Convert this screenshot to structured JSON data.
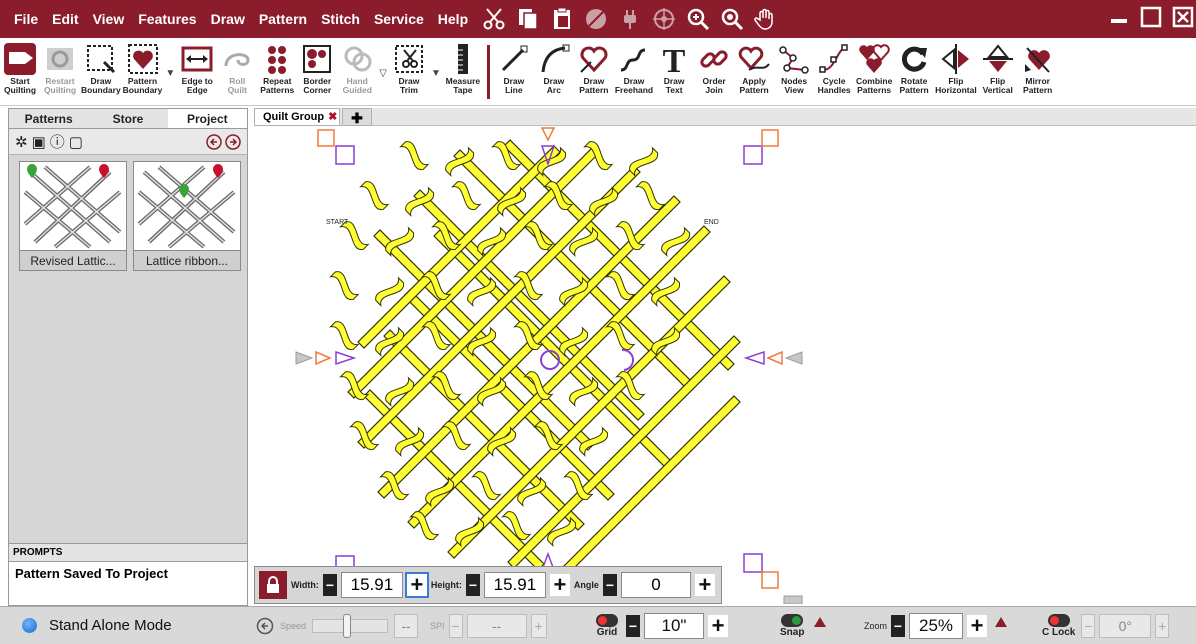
{
  "menu": [
    "File",
    "Edit",
    "View",
    "Features",
    "Draw",
    "Pattern",
    "Stitch",
    "Service",
    "Help"
  ],
  "menu_icons": [
    "scissors-icon",
    "copy-icon",
    "paste-icon",
    "no-entry-icon",
    "plug-icon",
    "crosshair-icon",
    "zoom-in-icon",
    "zoom-all-icon",
    "pan-hand-icon"
  ],
  "ribbon": [
    {
      "label": "Start\nQuilting",
      "icon": "start-quilting-icon",
      "disabled": false
    },
    {
      "label": "Restart\nQuilting",
      "icon": "restart-quilting-icon",
      "disabled": true
    },
    {
      "label": "Draw\nBoundary",
      "icon": "draw-boundary-icon",
      "disabled": false
    },
    {
      "label": "Pattern\nBoundary",
      "icon": "pattern-boundary-icon",
      "disabled": false,
      "dropdown": true
    },
    {
      "label": "Edge to\nEdge",
      "icon": "edge-to-edge-icon",
      "disabled": false
    },
    {
      "label": "Roll\nQuilt",
      "icon": "roll-quilt-icon",
      "disabled": true
    },
    {
      "label": "Repeat\nPatterns",
      "icon": "repeat-patterns-icon",
      "disabled": false
    },
    {
      "label": "Border\nCorner",
      "icon": "border-corner-icon",
      "disabled": false
    },
    {
      "label": "Hand\nGuided",
      "icon": "hand-guided-icon",
      "disabled": true,
      "dropdown": true
    },
    {
      "label": "Draw\nTrim",
      "icon": "draw-trim-icon",
      "disabled": false,
      "dropdown": true
    },
    {
      "label": "Measure\nTape",
      "icon": "measure-tape-icon",
      "disabled": false
    },
    {
      "label": "Draw\nLine",
      "icon": "draw-line-icon",
      "disabled": false
    },
    {
      "label": "Draw\nArc",
      "icon": "draw-arc-icon",
      "disabled": false
    },
    {
      "label": "Draw\nPattern",
      "icon": "draw-pattern-icon",
      "disabled": false
    },
    {
      "label": "Draw\nFreehand",
      "icon": "draw-freehand-icon",
      "disabled": false
    },
    {
      "label": "Draw\nText",
      "icon": "draw-text-icon",
      "disabled": false
    },
    {
      "label": "Order\nJoin",
      "icon": "order-join-icon",
      "disabled": false
    },
    {
      "label": "Apply\nPattern",
      "icon": "apply-pattern-icon",
      "disabled": false
    },
    {
      "label": "Nodes\nView",
      "icon": "nodes-view-icon",
      "disabled": false
    },
    {
      "label": "Cycle\nHandles",
      "icon": "cycle-handles-icon",
      "disabled": false
    },
    {
      "label": "Combine\nPatterns",
      "icon": "combine-patterns-icon",
      "disabled": false
    },
    {
      "label": "Rotate\nPattern",
      "icon": "rotate-pattern-icon",
      "disabled": false
    },
    {
      "label": "Flip\nHorizontal",
      "icon": "flip-horizontal-icon",
      "disabled": false
    },
    {
      "label": "Flip\nVertical",
      "icon": "flip-vertical-icon",
      "disabled": false
    },
    {
      "label": "Mirror\nPattern",
      "icon": "mirror-pattern-icon",
      "disabled": false
    }
  ],
  "left_panel": {
    "tabs": [
      "Patterns",
      "Store",
      "Project"
    ],
    "active_tab": "Project",
    "thumbnails": [
      {
        "caption": "Revised Lattic..."
      },
      {
        "caption": "Lattice ribbon..."
      }
    ]
  },
  "prompts": {
    "title": "PROMPTS",
    "text": "Pattern Saved To Project"
  },
  "doc_tab": {
    "label": "Quilt Group",
    "close": "✖",
    "add": "✚"
  },
  "canvas": {
    "start_label": "START",
    "end_label": "END"
  },
  "dimensions": {
    "width_label": "Width:",
    "width_value": "15.91",
    "height_label": "Height:",
    "height_value": "15.91",
    "angle_label": "Angle",
    "angle_value": "0"
  },
  "statusbar": {
    "mode": "Stand Alone Mode",
    "speed_label": "Speed",
    "speed_value": "--",
    "spi_label": "SPI",
    "spi_value": "--",
    "grid_label": "Grid",
    "grid_value": "10\"",
    "snap_label": "Snap",
    "zoom_label": "Zoom",
    "zoom_value": "25%",
    "clock_label": "C Lock",
    "clock_value": "0°"
  },
  "colors": {
    "brand": "#8a1c2b",
    "pattern_fill": "#ffff33",
    "pattern_stroke": "#333300",
    "handle_purple": "#8b3fd6",
    "handle_orange": "#f07a3a",
    "handle_gray": "#9a9a9a"
  }
}
